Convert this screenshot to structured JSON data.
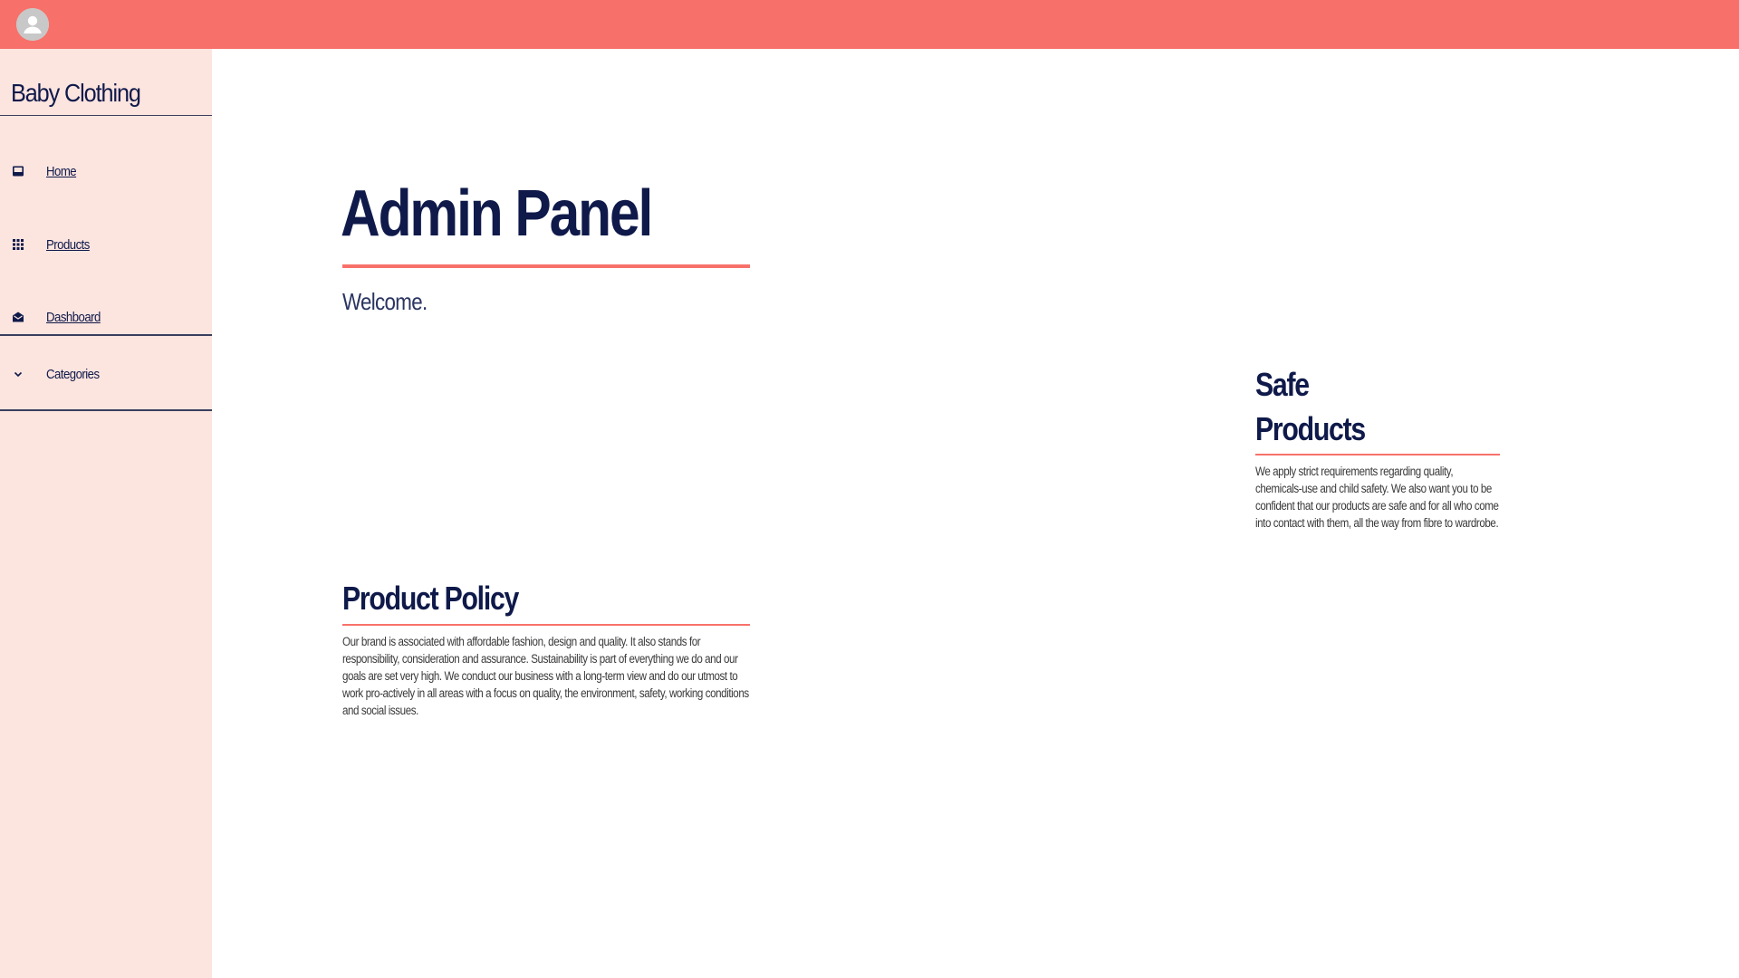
{
  "header": {
    "avatar_icon": "account-circle-icon",
    "background_color": "#f7716a"
  },
  "sidebar": {
    "brand": "Baby Clothing",
    "background_color": "#fce4df",
    "items": [
      {
        "label": "Home",
        "icon": "inbox-icon"
      },
      {
        "label": "Products",
        "icon": "grid-icon"
      },
      {
        "label": "Dashboard",
        "icon": "mail-open-icon"
      },
      {
        "label": "Categories",
        "icon": "chevron-down-icon"
      }
    ]
  },
  "main": {
    "title": "Admin Panel",
    "welcome": "Welcome.",
    "accent_color": "#f7716a",
    "policy": {
      "title": "Product Policy",
      "text": "Our brand is associated with affordable fashion, design and quality. It also stands for responsibility, consideration and assurance. Sustainability is part of everything we do and our goals are set very high. We conduct our business with a long-term view and do our utmost to work pro-actively in all areas with a focus on quality, the environment, safety, working conditions and social issues."
    },
    "safe": {
      "title": "Safe Products",
      "text": "We apply strict requirements regarding quality, chemicals-use and child safety. We also want you to be confident that our products are safe and for all who come into contact with them, all the way from fibre to wardrobe."
    }
  }
}
